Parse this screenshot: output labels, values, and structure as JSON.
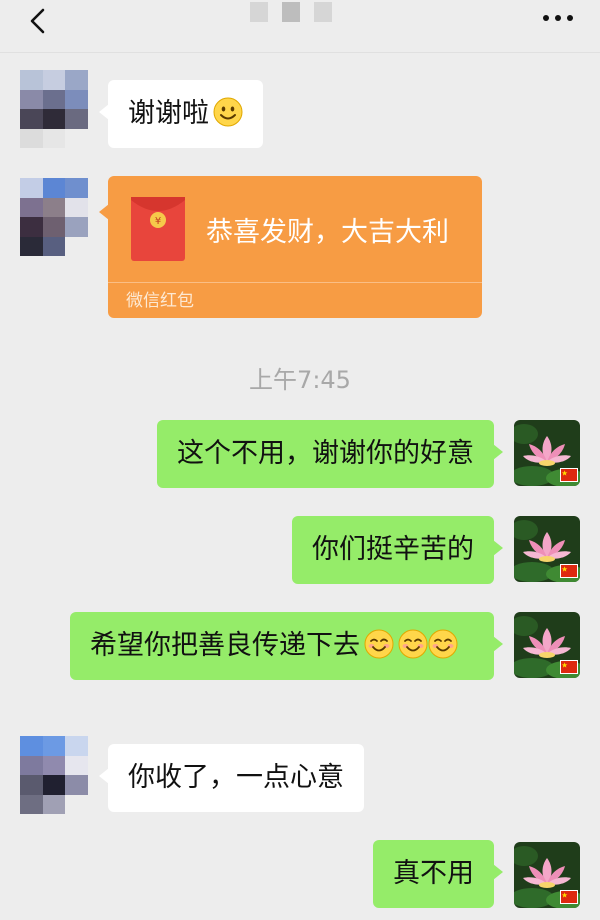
{
  "header": {
    "back_icon": "chevron-left-icon",
    "more_icon": "more-horizontal-icon"
  },
  "messages": [
    {
      "side": "left",
      "type": "text",
      "text": "谢谢啦",
      "emoji": "smile-emoji"
    },
    {
      "side": "left",
      "type": "red-packet",
      "title": "恭喜发财，大吉大利",
      "footer": "微信红包"
    },
    {
      "type": "timestamp",
      "text": "上午7:45"
    },
    {
      "side": "right",
      "type": "text",
      "text": "这个不用，谢谢你的好意"
    },
    {
      "side": "right",
      "type": "text",
      "text": "你们挺辛苦的"
    },
    {
      "side": "right",
      "type": "text",
      "text": "希望你把善良传递下去",
      "emoji": "blush-emoji x3"
    },
    {
      "side": "left",
      "type": "text",
      "text": "你收了，一点心意"
    },
    {
      "side": "right",
      "type": "text",
      "text": "真不用"
    }
  ],
  "colors": {
    "background": "#ededed",
    "self_bubble": "#95ec69",
    "other_bubble": "#ffffff",
    "red_packet": "#f79c44",
    "timestamp": "#a8a8a8"
  }
}
